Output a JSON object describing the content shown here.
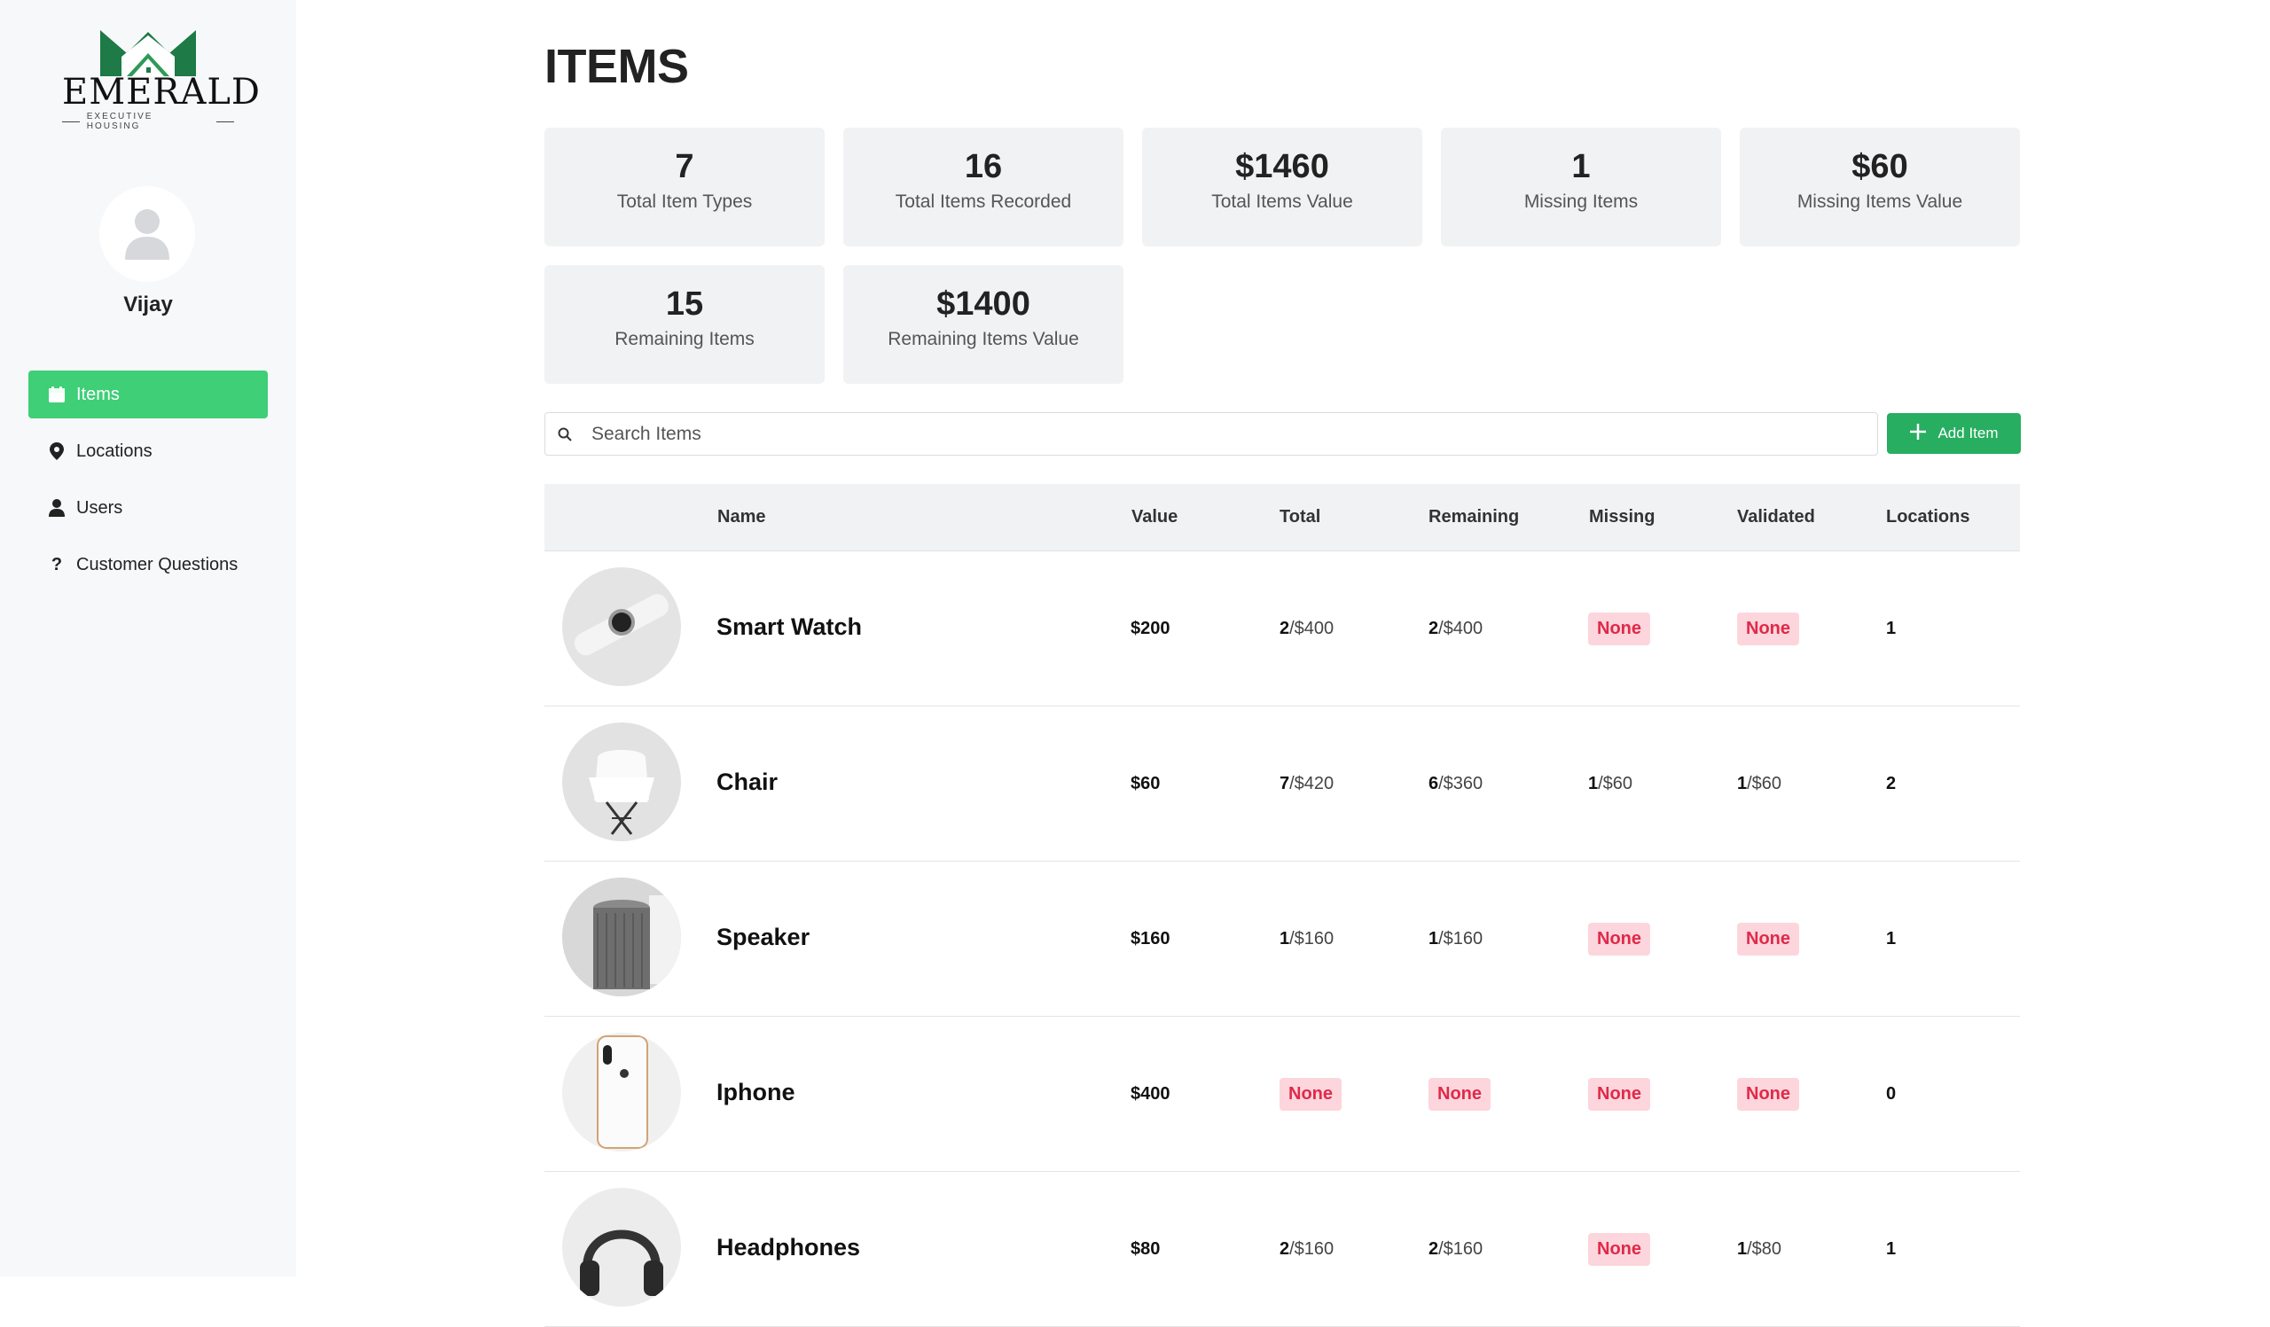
{
  "brand": {
    "name": "EMERALD",
    "tagline": "EXECUTIVE HOUSING",
    "colors": [
      "#1e7a47",
      "#3ecf77",
      "#0d2f1f"
    ]
  },
  "user": {
    "name": "Vijay",
    "avatar_icon": "user-icon"
  },
  "nav": {
    "items": [
      {
        "label": "Items",
        "icon": "box-icon",
        "active": true
      },
      {
        "label": "Locations",
        "icon": "map-pin-icon",
        "active": false
      },
      {
        "label": "Users",
        "icon": "user-icon",
        "active": false
      },
      {
        "label": "Customer Questions",
        "icon": "question-icon",
        "active": false
      }
    ]
  },
  "page": {
    "title": "ITEMS"
  },
  "stats": [
    {
      "value": "7",
      "label": "Total Item Types"
    },
    {
      "value": "16",
      "label": "Total Items Recorded"
    },
    {
      "value": "$1460",
      "label": "Total Items Value"
    },
    {
      "value": "1",
      "label": "Missing Items"
    },
    {
      "value": "$60",
      "label": "Missing Items Value"
    },
    {
      "value": "15",
      "label": "Remaining Items"
    },
    {
      "value": "$1400",
      "label": "Remaining Items Value"
    }
  ],
  "search": {
    "placeholder": "Search Items",
    "value": ""
  },
  "actions": {
    "add_item": "Add Item"
  },
  "table": {
    "columns": [
      "Name",
      "Value",
      "Total",
      "Remaining",
      "Missing",
      "Validated",
      "Locations"
    ],
    "rows": [
      {
        "name": "Smart Watch",
        "image": "smart-watch",
        "value": "$200",
        "total": {
          "count": "2",
          "amount": "/$400"
        },
        "remaining": {
          "count": "2",
          "amount": "/$400"
        },
        "missing": {
          "none": "None"
        },
        "validated": {
          "none": "None"
        },
        "locations": "1"
      },
      {
        "name": "Chair",
        "image": "chair",
        "value": "$60",
        "total": {
          "count": "7",
          "amount": "/$420"
        },
        "remaining": {
          "count": "6",
          "amount": "/$360"
        },
        "missing": {
          "count": "1",
          "amount": "/$60"
        },
        "validated": {
          "count": "1",
          "amount": "/$60"
        },
        "locations": "2"
      },
      {
        "name": "Speaker",
        "image": "speaker",
        "value": "$160",
        "total": {
          "count": "1",
          "amount": "/$160"
        },
        "remaining": {
          "count": "1",
          "amount": "/$160"
        },
        "missing": {
          "none": "None"
        },
        "validated": {
          "none": "None"
        },
        "locations": "1"
      },
      {
        "name": "Iphone",
        "image": "iphone",
        "value": "$400",
        "total": {
          "none": "None"
        },
        "remaining": {
          "none": "None"
        },
        "missing": {
          "none": "None"
        },
        "validated": {
          "none": "None"
        },
        "locations": "0"
      },
      {
        "name": "Headphones",
        "image": "headphones",
        "value": "$80",
        "total": {
          "count": "2",
          "amount": "/$160"
        },
        "remaining": {
          "count": "2",
          "amount": "/$160"
        },
        "missing": {
          "none": "None"
        },
        "validated": {
          "count": "1",
          "amount": "/$80"
        },
        "locations": "1"
      }
    ]
  }
}
